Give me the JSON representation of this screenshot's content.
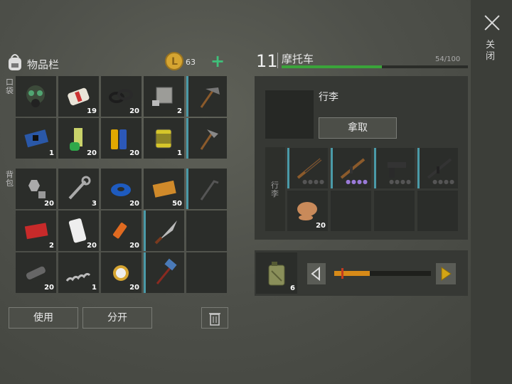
{
  "inventory": {
    "title": "物品栏",
    "coins": "63",
    "plus_label": "+",
    "pocket_label": "口袋",
    "backpack_label": "背包",
    "pocket_items": [
      {
        "icon": "gas-mask-icon",
        "count": ""
      },
      {
        "icon": "bandage-icon",
        "count": "19"
      },
      {
        "icon": "rubber-ring-icon",
        "count": "20"
      },
      {
        "icon": "engine-part-icon",
        "count": "2"
      },
      {
        "icon": "pickaxe-icon",
        "count": ""
      },
      {
        "icon": "circuit-board-icon",
        "count": "1"
      },
      {
        "icon": "spray-can-icon",
        "count": "20"
      },
      {
        "icon": "battery-icon",
        "count": "20"
      },
      {
        "icon": "oil-filter-icon",
        "count": "1"
      },
      {
        "icon": "hammer-axe-icon",
        "count": ""
      }
    ],
    "backpack_items": [
      {
        "icon": "bolt-nut-icon",
        "count": "20"
      },
      {
        "icon": "wrench-icon",
        "count": "3"
      },
      {
        "icon": "duct-tape-icon",
        "count": "20"
      },
      {
        "icon": "coupon-icon",
        "count": "50"
      },
      {
        "icon": "crowbar-icon",
        "count": ""
      },
      {
        "icon": "red-coupon-icon",
        "count": "2"
      },
      {
        "icon": "smartphone-icon",
        "count": "20"
      },
      {
        "icon": "usb-stick-icon",
        "count": "20"
      },
      {
        "icon": "machete-icon",
        "count": ""
      },
      {
        "icon": "empty-slot",
        "count": ""
      },
      {
        "icon": "flashlight-icon",
        "count": "20"
      },
      {
        "icon": "spring-icon",
        "count": "1"
      },
      {
        "icon": "gold-watch-icon",
        "count": "20"
      },
      {
        "icon": "sledgehammer-icon",
        "count": ""
      },
      {
        "icon": "empty-slot",
        "count": ""
      }
    ],
    "use_button": "使用",
    "split_button": "分开"
  },
  "vehicle": {
    "level": "11",
    "name": "摩托车",
    "capacity": "54/100",
    "capacity_fraction": 0.54,
    "luggage_title": "行李",
    "take_button": "拿取",
    "luggage_side_label": "行李",
    "weapons": [
      {
        "icon": "shotgun-icon",
        "dots": "●●●●",
        "purple": false
      },
      {
        "icon": "ak-rifle-icon",
        "dots": "●●●●",
        "purple": true
      },
      {
        "icon": "pistol-icon",
        "dots": "●●●●",
        "purple": false
      },
      {
        "icon": "assault-rifle-icon",
        "dots": "●●●●",
        "purple": false
      }
    ],
    "extra_item": {
      "icon": "fuel-filter-icon",
      "count": "20"
    },
    "fuel": {
      "count": "6",
      "level_fraction": 0.37
    }
  },
  "close_label": "关闭",
  "colors": {
    "accent": "#4a9aa8",
    "capacity_bar": "#3aa43a",
    "coin": "#d6a531",
    "fuel_bar": "#d78a18",
    "arrow_right": "#d4a514"
  }
}
